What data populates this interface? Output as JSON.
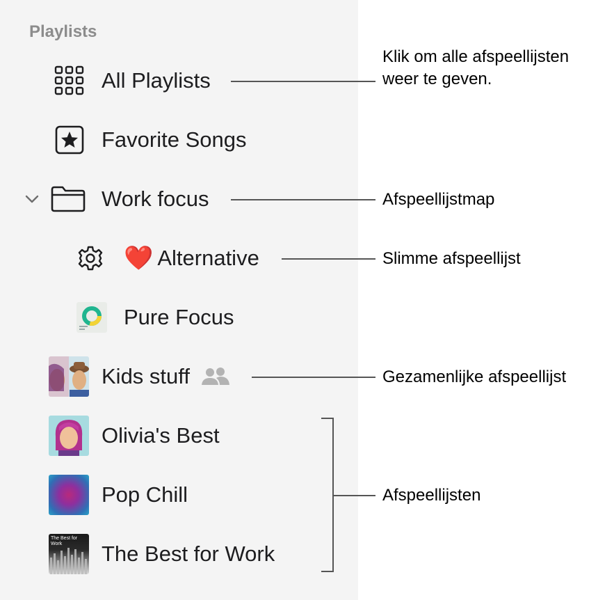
{
  "sidebar": {
    "section_title": "Playlists",
    "items": {
      "all_playlists": {
        "label": "All Playlists",
        "icon": "grid-icon"
      },
      "favorite_songs": {
        "label": "Favorite Songs",
        "icon": "star-box-icon"
      },
      "work_focus": {
        "label": "Work focus",
        "icon": "folder-icon",
        "expanded": true
      },
      "alternative": {
        "label": "Alternative",
        "icon": "gear-icon",
        "emoji": "❤️"
      },
      "pure_focus": {
        "label": "Pure Focus",
        "icon": "pure-focus-artwork"
      },
      "kids_stuff": {
        "label": "Kids stuff",
        "icon": "memoji-pair-artwork",
        "badge": "shared-people-icon"
      },
      "olivias_best": {
        "label": "Olivia's Best",
        "icon": "memoji-artwork"
      },
      "pop_chill": {
        "label": "Pop Chill",
        "icon": "pop-chill-artwork"
      },
      "best_for_work": {
        "label": "The Best for Work",
        "icon": "best-for-work-artwork",
        "artwork_text": "The Best for Work"
      }
    }
  },
  "callouts": {
    "all_playlists_line1": "Klik om alle afspeellijsten",
    "all_playlists_line2": "weer te geven.",
    "folder": "Afspeellijstmap",
    "smart": "Slimme afspeellijst",
    "shared": "Gezamenlijke afspeellijst",
    "playlists": "Afspeellijsten"
  },
  "colors": {
    "sidebar_bg": "#f4f4f4",
    "section_title": "#8c8c8c",
    "text": "#1d1d1f",
    "callout_line": "#555555"
  }
}
